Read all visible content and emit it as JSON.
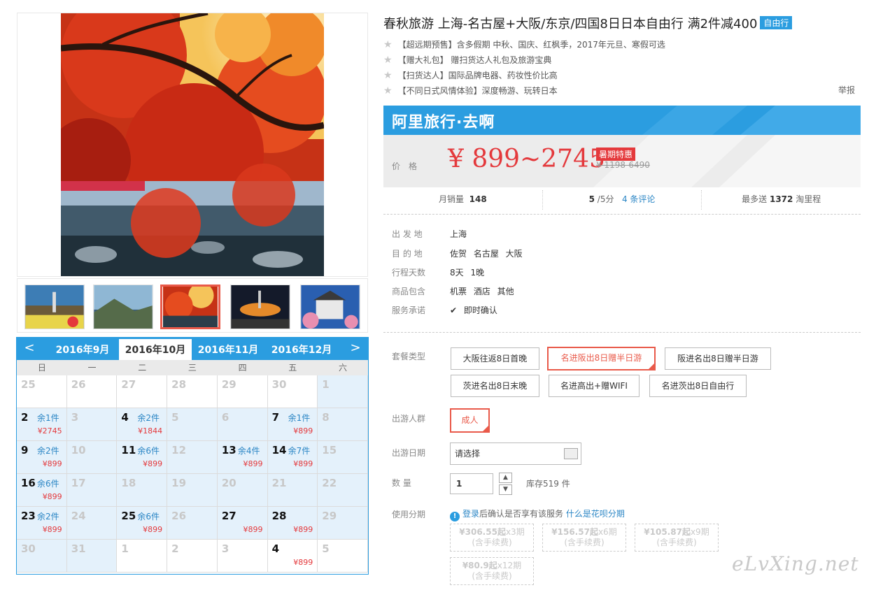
{
  "product": {
    "title": "春秋旅游 上海-名古屋+大阪/东京/四国8日日本自由行 满2件减400",
    "badge": "自由行",
    "features": [
      "【超远期预售】含多假期 中秋、国庆、红枫季，2017年元旦、寒假可选",
      "【赠大礼包】 赠扫货达人礼包及旅游宝典",
      "【扫货达人】国际品牌电器、药妆性价比高",
      "【不同日式风情体验】深度畅游、玩转日本"
    ],
    "report": "举报"
  },
  "promo": {
    "brand": "阿里旅行·去啊",
    "price_label": "价格",
    "price": "¥ 899~2745",
    "badge": "暑期特惠",
    "original_price": "¥ 1198-6490"
  },
  "stats": {
    "monthly_sales_label": "月销量",
    "monthly_sales": "148",
    "rating": "5",
    "rating_suffix": "/5分",
    "reviews": "4 条评论",
    "points_label": "最多送",
    "points": "1372",
    "points_suffix": "淘里程"
  },
  "info": [
    {
      "label": "出 发 地",
      "value": "上海"
    },
    {
      "label": "目 的 地",
      "value": "佐贺 名古屋 大阪"
    },
    {
      "label": "行程天数",
      "value": "8天 1晚"
    },
    {
      "label": "商品包含",
      "value": "机票 酒店 其他"
    },
    {
      "label": "服务承诺",
      "value": "即时确认"
    }
  ],
  "package": {
    "label": "套餐类型",
    "options": [
      "大阪往返8日首晚",
      "名进阪出8日赠半日游",
      "阪进名出8日赠半日游",
      "茨进名出8日末晚",
      "名进高出+赠WIFI",
      "名进茨出8日自由行"
    ],
    "selected_index": 1
  },
  "travelers": {
    "label": "出游人群",
    "option": "成人"
  },
  "travel_date": {
    "label": "出游日期",
    "placeholder": "请选择"
  },
  "quantity": {
    "label": "数 量",
    "value": "1",
    "stock": "库存519 件"
  },
  "installment": {
    "label": "使用分期",
    "login": "登录",
    "note": "后确认是否享有该服务",
    "link": "什么是花呗分期",
    "plans": [
      {
        "amount": "¥306.55起",
        "periods": "x3期",
        "fee": "(含手续费)"
      },
      {
        "amount": "¥156.57起",
        "periods": "x6期",
        "fee": "(含手续费)"
      },
      {
        "amount": "¥105.87起",
        "periods": "x9期",
        "fee": "(含手续费)"
      },
      {
        "amount": "¥80.9起",
        "periods": "x12期",
        "fee": "(含手续费)"
      }
    ]
  },
  "calendar": {
    "prev": "<",
    "next": ">",
    "months": [
      "2016年9月",
      "2016年10月",
      "2016年11月",
      "2016年12月"
    ],
    "active_month_index": 1,
    "weekdays": [
      "日",
      "一",
      "二",
      "三",
      "四",
      "五",
      "六"
    ],
    "days": [
      {
        "d": "25",
        "rem": "",
        "price": "",
        "avail": false,
        "blue": false
      },
      {
        "d": "26",
        "rem": "",
        "price": "",
        "avail": false,
        "blue": false
      },
      {
        "d": "27",
        "rem": "",
        "price": "",
        "avail": false,
        "blue": false
      },
      {
        "d": "28",
        "rem": "",
        "price": "",
        "avail": false,
        "blue": false
      },
      {
        "d": "29",
        "rem": "",
        "price": "",
        "avail": false,
        "blue": false
      },
      {
        "d": "30",
        "rem": "",
        "price": "",
        "avail": false,
        "blue": false
      },
      {
        "d": "1",
        "rem": "",
        "price": "",
        "avail": false,
        "blue": true
      },
      {
        "d": "2",
        "rem": "余1件",
        "price": "¥2745",
        "avail": true,
        "blue": true
      },
      {
        "d": "3",
        "rem": "",
        "price": "",
        "avail": false,
        "blue": true
      },
      {
        "d": "4",
        "rem": "余2件",
        "price": "¥1844",
        "avail": true,
        "blue": true
      },
      {
        "d": "5",
        "rem": "",
        "price": "",
        "avail": false,
        "blue": true
      },
      {
        "d": "6",
        "rem": "",
        "price": "",
        "avail": false,
        "blue": true
      },
      {
        "d": "7",
        "rem": "余1件",
        "price": "¥899",
        "avail": true,
        "blue": true
      },
      {
        "d": "8",
        "rem": "",
        "price": "",
        "avail": false,
        "blue": true
      },
      {
        "d": "9",
        "rem": "余2件",
        "price": "¥899",
        "avail": true,
        "blue": true
      },
      {
        "d": "10",
        "rem": "",
        "price": "",
        "avail": false,
        "blue": true
      },
      {
        "d": "11",
        "rem": "余6件",
        "price": "¥899",
        "avail": true,
        "blue": true
      },
      {
        "d": "12",
        "rem": "",
        "price": "",
        "avail": false,
        "blue": true
      },
      {
        "d": "13",
        "rem": "余4件",
        "price": "¥899",
        "avail": true,
        "blue": true
      },
      {
        "d": "14",
        "rem": "余7件",
        "price": "¥899",
        "avail": true,
        "blue": true
      },
      {
        "d": "15",
        "rem": "",
        "price": "",
        "avail": false,
        "blue": true
      },
      {
        "d": "16",
        "rem": "余6件",
        "price": "¥899",
        "avail": true,
        "blue": true
      },
      {
        "d": "17",
        "rem": "",
        "price": "",
        "avail": false,
        "blue": true
      },
      {
        "d": "18",
        "rem": "",
        "price": "",
        "avail": false,
        "blue": true
      },
      {
        "d": "19",
        "rem": "",
        "price": "",
        "avail": false,
        "blue": true
      },
      {
        "d": "20",
        "rem": "",
        "price": "",
        "avail": false,
        "blue": true
      },
      {
        "d": "21",
        "rem": "",
        "price": "",
        "avail": false,
        "blue": true
      },
      {
        "d": "22",
        "rem": "",
        "price": "",
        "avail": false,
        "blue": true
      },
      {
        "d": "23",
        "rem": "余2件",
        "price": "¥899",
        "avail": true,
        "blue": true
      },
      {
        "d": "24",
        "rem": "",
        "price": "",
        "avail": false,
        "blue": true
      },
      {
        "d": "25",
        "rem": "余6件",
        "price": "¥899",
        "avail": true,
        "blue": true
      },
      {
        "d": "26",
        "rem": "",
        "price": "",
        "avail": false,
        "blue": true
      },
      {
        "d": "27",
        "rem": "",
        "price": "¥899",
        "avail": true,
        "blue": true
      },
      {
        "d": "28",
        "rem": "",
        "price": "¥899",
        "avail": true,
        "blue": true
      },
      {
        "d": "29",
        "rem": "",
        "price": "",
        "avail": false,
        "blue": true
      },
      {
        "d": "30",
        "rem": "",
        "price": "",
        "avail": false,
        "blue": true
      },
      {
        "d": "31",
        "rem": "",
        "price": "",
        "avail": false,
        "blue": true
      },
      {
        "d": "1",
        "rem": "",
        "price": "",
        "avail": false,
        "blue": false
      },
      {
        "d": "2",
        "rem": "",
        "price": "",
        "avail": false,
        "blue": false
      },
      {
        "d": "3",
        "rem": "",
        "price": "",
        "avail": false,
        "blue": false
      },
      {
        "d": "4",
        "rem": "",
        "price": "¥899",
        "avail": true,
        "blue": false
      },
      {
        "d": "5",
        "rem": "",
        "price": "",
        "avail": false,
        "blue": false
      }
    ]
  },
  "watermark": "eLvXing.net",
  "colors": {
    "accent_blue": "#2b9de0",
    "price_red": "#e4393c",
    "selected_border": "#e95a4a"
  }
}
